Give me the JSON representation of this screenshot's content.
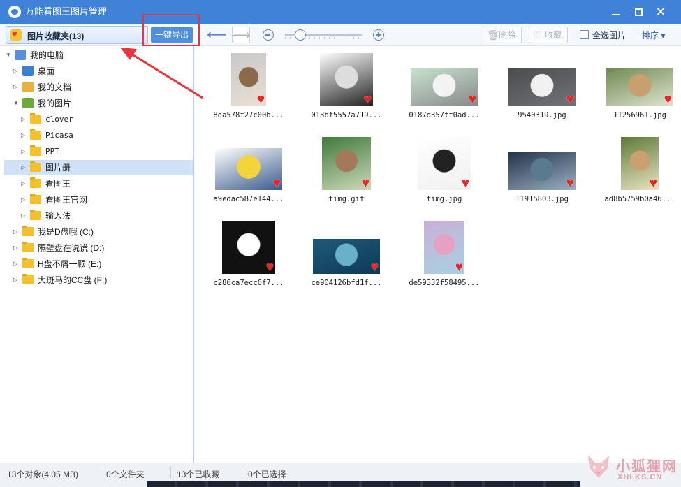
{
  "window": {
    "title": "万能看图王图片管理"
  },
  "toolbar": {
    "favorites_label": "图片收藏夹(13)",
    "export_label": "一键导出",
    "delete_label": "删除",
    "collect_label": "收藏",
    "select_all_label": "全选图片",
    "sort_label": "排序",
    "zoom_level": 0.2
  },
  "tree": {
    "computer": "我的电脑",
    "desktop": "桌面",
    "documents": "我的文档",
    "pictures": "我的图片",
    "folders": [
      "clover",
      "Picasa",
      "PPT",
      "图片册",
      "看图王",
      "看图王官网",
      "输入法"
    ],
    "drives": [
      "我是D盘哦 (C:)",
      "隔壁盘在说谎 (D:)",
      "H盘不屑一顾 (E:)",
      "大斑马的CC盘 (F:)"
    ]
  },
  "images": [
    {
      "name": "8da578f27c00b...",
      "colors": [
        "#c9c9c9",
        "#8a6a48",
        "#e8e0d2"
      ]
    },
    {
      "name": "013bf5557a719...",
      "colors": [
        "#ffffff",
        "#dddddd",
        "#222222"
      ]
    },
    {
      "name": "0187d357ff0ad...",
      "colors": [
        "#c7e3cf",
        "#f3f3f3",
        "#888888"
      ]
    },
    {
      "name": "9540319.jpg",
      "colors": [
        "#4a4c50",
        "#f1f1f1",
        "#707377"
      ]
    },
    {
      "name": "11256961.jpg",
      "colors": [
        "#6f8a52",
        "#c8a070",
        "#dfe4d0"
      ]
    },
    {
      "name": "a9edac587e144...",
      "colors": [
        "#ffffff",
        "#f3d43a",
        "#3b5b8c"
      ]
    },
    {
      "name": "timg.gif",
      "colors": [
        "#3f7a3b",
        "#a27a5a",
        "#ccd8b8"
      ]
    },
    {
      "name": "timg.jpg",
      "colors": [
        "#ffffff",
        "#222222",
        "#f0f0f0"
      ]
    },
    {
      "name": "11915803.jpg",
      "colors": [
        "#23344a",
        "#5a7a90",
        "#9ab0c0"
      ]
    },
    {
      "name": "ad8b5759b0a46...",
      "colors": [
        "#5f7a3a",
        "#caa070",
        "#e8e2c0"
      ]
    },
    {
      "name": "c286ca7ecc6f7...",
      "colors": [
        "#111111",
        "#ffffff",
        "#111111"
      ]
    },
    {
      "name": "ce904126bfd1f...",
      "colors": [
        "#1f5a7a",
        "#6ab0c8",
        "#0d3a55"
      ]
    },
    {
      "name": "de59332f58495...",
      "colors": [
        "#c9b0d8",
        "#e8a0c0",
        "#a8d0e0"
      ]
    }
  ],
  "status": {
    "objects": "13个对象(4.05 MB)",
    "folders": "0个文件夹",
    "favorited": "13个已收藏",
    "selected": "0个已选择"
  },
  "watermark": {
    "text": "小狐狸网",
    "sub": "XHLKS.CN"
  },
  "colors": {
    "accent": "#3f82d8",
    "heart": "#ee2222",
    "annotation": "#e8343a"
  }
}
